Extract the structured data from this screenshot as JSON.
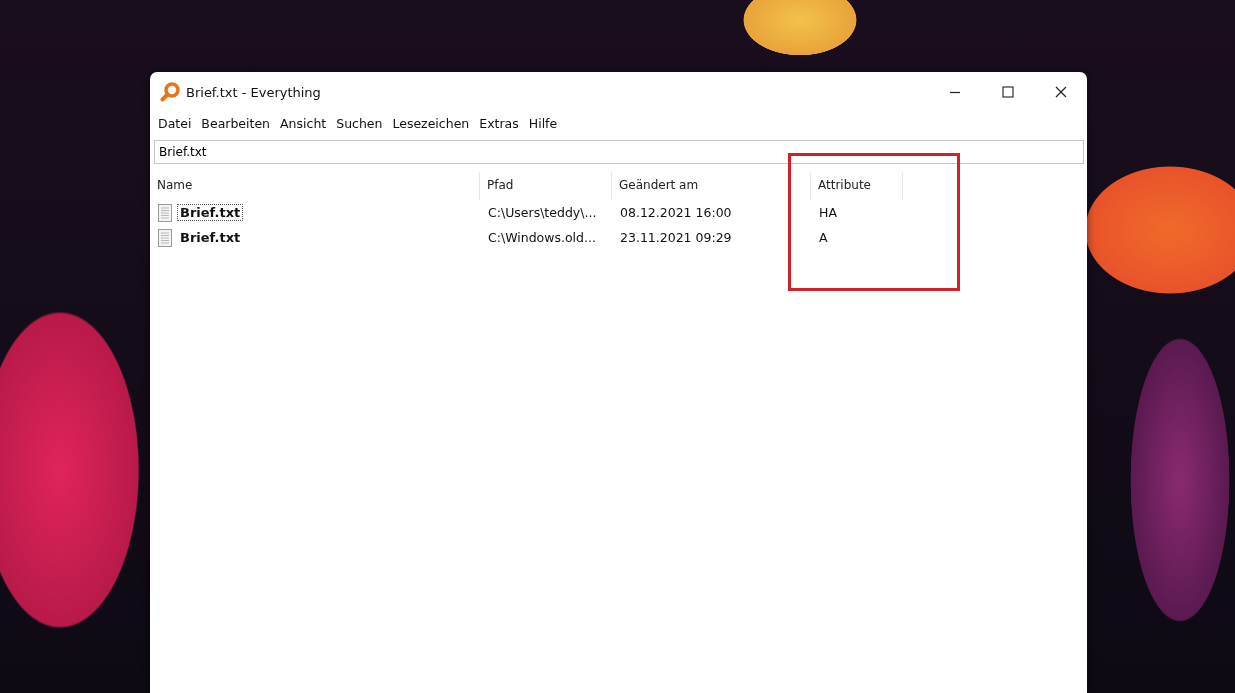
{
  "window": {
    "title": "Brief.txt - Everything"
  },
  "menu": [
    "Datei",
    "Bearbeiten",
    "Ansicht",
    "Suchen",
    "Lesezeichen",
    "Extras",
    "Hilfe"
  ],
  "search": {
    "value": "Brief.txt"
  },
  "table": {
    "columns": [
      "Name",
      "Pfad",
      "Geändert am",
      "Attribute"
    ],
    "rows": [
      {
        "name": "Brief.txt",
        "path": "C:\\Users\\teddy\\...",
        "modified": "08.12.2021 16:00",
        "attributes": "HA",
        "focused": true
      },
      {
        "name": "Brief.txt",
        "path": "C:\\Windows.old...",
        "modified": "23.11.2021 09:29",
        "attributes": "A",
        "focused": false
      }
    ]
  }
}
